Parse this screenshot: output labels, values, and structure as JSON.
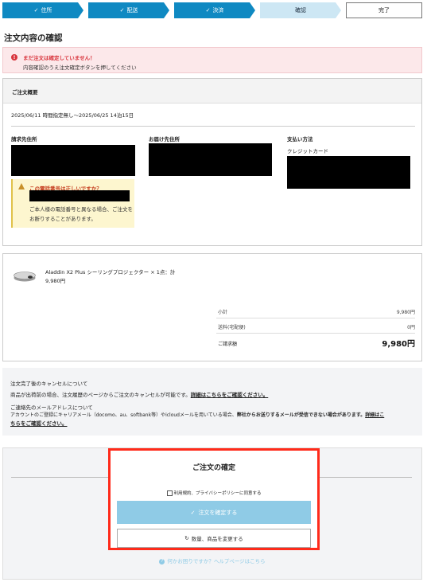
{
  "steps": [
    {
      "label": "住所",
      "check": "✓"
    },
    {
      "label": "配送",
      "check": "✓"
    },
    {
      "label": "決済",
      "check": "✓"
    },
    {
      "label": "確認",
      "check": ""
    },
    {
      "label": "完了",
      "check": ""
    }
  ],
  "page_title": "注文内容の確認",
  "alert": {
    "icon": "!",
    "title": "まだ注文は確定していません！",
    "body": "内容確認のうえ注文確定ボタンを押してください"
  },
  "summary": {
    "heading": "ご注文概要",
    "delivery": "2025/06/11 時間指定無し〜2025/06/25 14泊15日",
    "billing_label": "請求先住所",
    "shipping_label": "お届け先住所",
    "payment_label": "支払い方法",
    "payment_value": "クレジットカード",
    "warning_title": "この電話番号は正しいですか？",
    "warning_body": "ご本人様の電話番号と異なる場合、ご注文をお断りすることがあります。"
  },
  "product": {
    "name": "Aladdin X2 Plus シーリングプロジェクター × 1点：計9,980円",
    "totals": [
      {
        "label": "小計",
        "value": "9,980円"
      },
      {
        "label": "送料(宅配便)",
        "value": "0円"
      },
      {
        "label": "ご請求額",
        "value": "9,980円"
      }
    ]
  },
  "notice": {
    "cancel_title": "注文完了後のキャンセルについて",
    "cancel_body": "商品が出荷前の場合、注文履歴のページからご注文のキャンセルが可能です。",
    "cancel_link": "詳細はこちらをご確認ください。",
    "mail_title": "ご連絡先のメールアドレスについて",
    "mail_body": "アカウントのご登録にキャリアメール（docomo、au、softbank等）やicloudメールを用いている場合、",
    "mail_bold": "弊社からお送りするメールが受信できない場合があります。",
    "mail_link1": "詳細はこ",
    "mail_link2": "ちらをご確認ください。"
  },
  "confirm": {
    "title": "ご注文の確定",
    "agree_label": "利用規約、プライバシーポリシーに同意する",
    "confirm_button": "注文を確定する",
    "confirm_check": "✓",
    "change_button": "数量、商品を変更する",
    "change_icon": "↻",
    "help_icon": "?",
    "help_text": "何かお困りですか？ヘルプページはこちら"
  }
}
